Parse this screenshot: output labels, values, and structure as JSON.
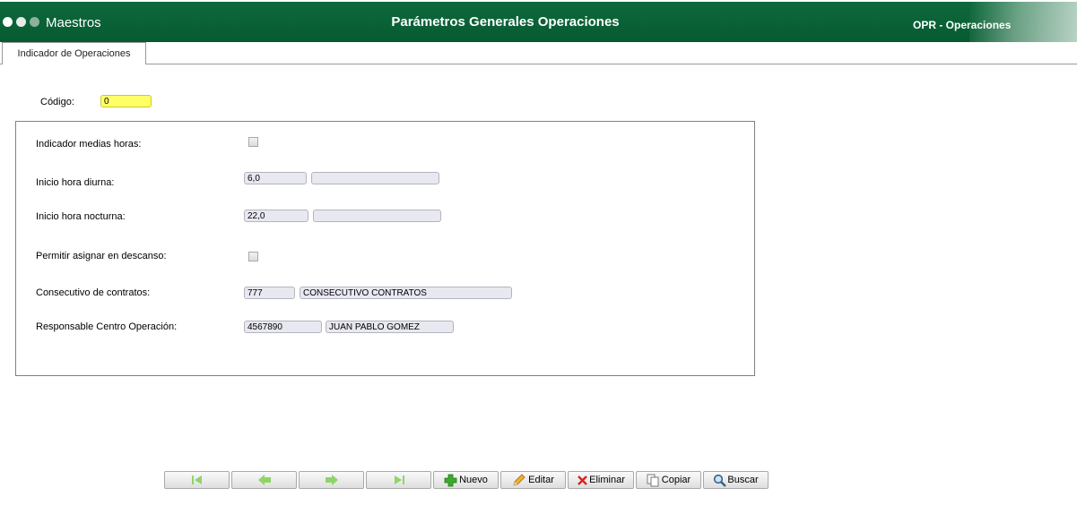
{
  "header": {
    "app_title": "Maestros",
    "page_title": "Parámetros Generales Operaciones",
    "module_name": "OPR - Operaciones",
    "bg_color": "#0b6438"
  },
  "tabs": [
    {
      "label": "Indicador de Operaciones",
      "active": true
    }
  ],
  "form": {
    "codigo_label": "Código:",
    "codigo_value": "0",
    "fields": {
      "medias_horas": {
        "label": "Indicador medias horas:",
        "checked": false
      },
      "hora_diurna": {
        "label": "Inicio hora diurna:",
        "value": "6,0",
        "description": ""
      },
      "hora_nocturna": {
        "label": "Inicio hora nocturna:",
        "value": "22,0",
        "description": ""
      },
      "asignar_descanso": {
        "label": "Permitir asignar en descanso:",
        "checked": false
      },
      "consecutivo": {
        "label": "Consecutivo de contratos:",
        "value": "777",
        "description": "CONSECUTIVO CONTRATOS"
      },
      "responsable": {
        "label": "Responsable Centro Operación:",
        "value": "4567890",
        "description": "JUAN PABLO GOMEZ"
      }
    }
  },
  "toolbar": {
    "first_icon": "first-record-icon",
    "prev_icon": "previous-record-icon",
    "next_icon": "next-record-icon",
    "last_icon": "last-record-icon",
    "nuevo": "Nuevo",
    "editar": "Editar",
    "eliminar": "Eliminar",
    "copiar": "Copiar",
    "buscar": "Buscar",
    "nav_color": "#8fd46a"
  }
}
